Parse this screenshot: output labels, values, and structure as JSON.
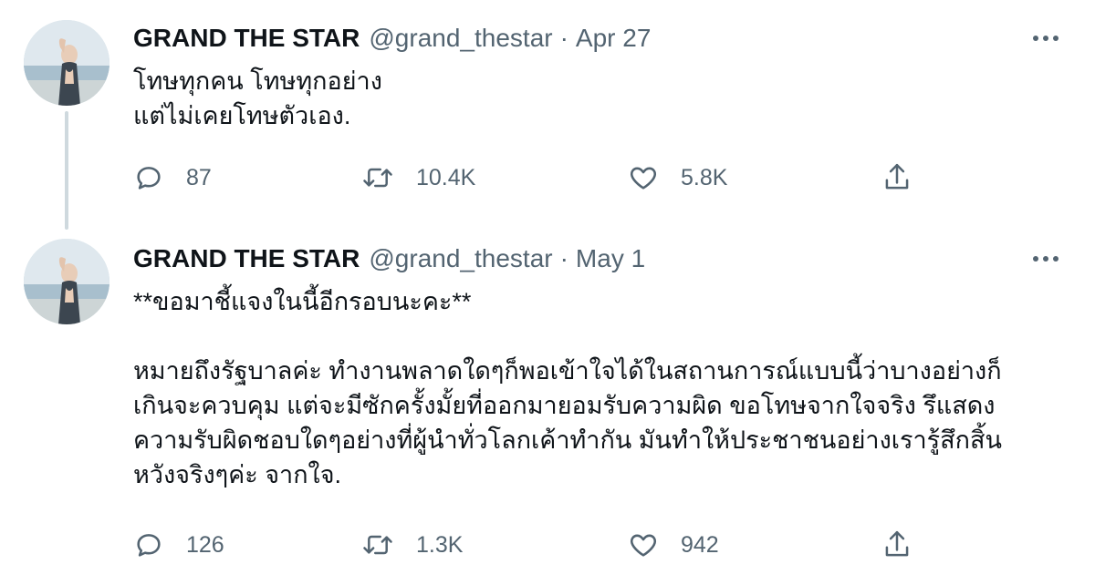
{
  "tweets": [
    {
      "author_name": "GRAND THE STAR",
      "handle": "@grand_thestar",
      "separator": "·",
      "date": "Apr 27",
      "text_lines": [
        "โทษทุกคน โทษทุกอย่าง",
        "แต่ไม่เคยโทษตัวเอง."
      ],
      "replies": "87",
      "retweets": "10.4K",
      "likes": "5.8K",
      "icons": {
        "reply": "reply-icon",
        "retweet": "retweet-icon",
        "like": "heart-icon",
        "share": "share-icon",
        "more": "more-icon"
      }
    },
    {
      "author_name": "GRAND THE STAR",
      "handle": "@grand_thestar",
      "separator": "·",
      "date": "May 1",
      "text_first": "**ขอมาชี้แจงในนี้อีกรอบนะคะ**",
      "text_lines": [
        "หมายถึงรัฐบาลค่ะ ทำงานพลาดใดๆก็พอเข้าใจได้ในสถานการณ์แบบนี้ว่าบางอย่างก็",
        "เกินจะควบคุม แต่จะมีซักครั้งมั้ยที่ออกมายอมรับความผิด ขอโทษจากใจจริง รึแสดง",
        "ความรับผิดชอบใดๆอย่างที่ผู้นำทั่วโลกเค้าทำกัน มันทำให้ประชาชนอย่างเรารู้สึกสิ้น",
        "หวังจริงๆค่ะ จากใจ."
      ],
      "replies": "126",
      "retweets": "1.3K",
      "likes": "942",
      "icons": {
        "reply": "reply-icon",
        "retweet": "retweet-icon",
        "like": "heart-icon",
        "share": "share-icon",
        "more": "more-icon"
      }
    }
  ],
  "colors": {
    "text_primary": "#0f1419",
    "text_secondary": "#536471",
    "thread_line": "#cfd9de",
    "background": "#ffffff"
  }
}
